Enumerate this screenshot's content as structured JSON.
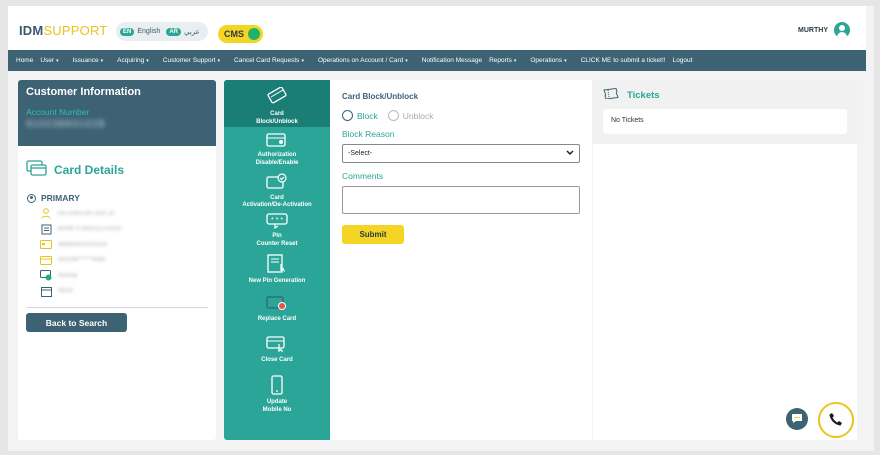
{
  "header": {
    "logo_idm": "IDM",
    "logo_support": "SUPPORT",
    "lang_en_code": "EN",
    "lang_en_label": "English",
    "lang_ar_code": "AR",
    "lang_ar_label": "عربي",
    "cms_label": "CMS",
    "username": "MURTHY"
  },
  "nav": [
    {
      "label": "Home",
      "dropdown": false
    },
    {
      "label": "User",
      "dropdown": true
    },
    {
      "label": "Issuance",
      "dropdown": true
    },
    {
      "label": "Acquiring",
      "dropdown": true
    },
    {
      "label": "Customer Support",
      "dropdown": true
    },
    {
      "label": "Cancel Card Requests",
      "dropdown": true
    },
    {
      "label": "Operations on Account / Card",
      "dropdown": true
    },
    {
      "label": "Notification Message",
      "dropdown": false
    },
    {
      "label": "Reports",
      "dropdown": true
    },
    {
      "label": "Operations",
      "dropdown": true
    },
    {
      "label": "CLICK ME to submit a ticket!!",
      "dropdown": false
    },
    {
      "label": "Logout",
      "dropdown": false
    }
  ],
  "customer": {
    "title": "Customer Information",
    "account_label": "Account Number",
    "account_number": "91023883102B"
  },
  "card_details": {
    "title": "Card Details",
    "primary_label": "PRIMARY",
    "rows": [
      "HA SAMTAN SAH JA",
      "BAHK A ABDULLA2022",
      "4999HAP0000254",
      "442244******4489",
      "Normal",
      "06/29"
    ],
    "back_button": "Back to Search"
  },
  "operations": [
    {
      "label": "Card\nBlock/Unblock",
      "icon": "card-block-icon"
    },
    {
      "label": "Authorization\nDisable/Enable",
      "icon": "authorization-icon"
    },
    {
      "label": "Card\nActivation/De-Activation",
      "icon": "card-activation-icon"
    },
    {
      "label": "Pin\nCounter Reset",
      "icon": "pin-reset-icon"
    },
    {
      "label": "New Pin Generation",
      "icon": "pin-generation-icon"
    },
    {
      "label": "Replace Card",
      "icon": "replace-card-icon"
    },
    {
      "label": "Close Card",
      "icon": "close-card-icon"
    },
    {
      "label": "Update\nMobile No",
      "icon": "mobile-icon"
    }
  ],
  "form": {
    "title": "Card Block/Unblock",
    "block_label": "Block",
    "unblock_label": "Unblock",
    "reason_label": "Block Reason",
    "reason_value": "-Select-",
    "comments_label": "Comments",
    "submit_label": "Submit"
  },
  "tickets": {
    "title": "Tickets",
    "empty_text": "No Tickets"
  },
  "colors": {
    "primary": "#3d6274",
    "teal": "#2aa597",
    "yellow": "#f5d523"
  }
}
